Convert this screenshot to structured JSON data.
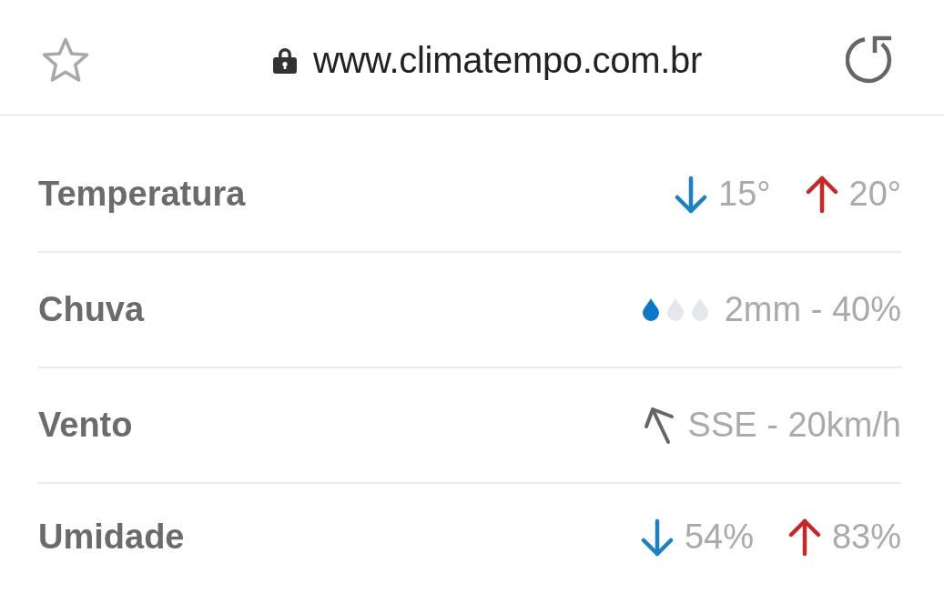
{
  "toolbar": {
    "bookmarked": false,
    "url": "www.climatempo.com.br"
  },
  "rows": [
    {
      "kind": "range",
      "label": "Temperatura",
      "min": "15°",
      "max": "20°"
    },
    {
      "kind": "rain",
      "label": "Chuva",
      "drops": [
        {
          "filled": true
        },
        {
          "filled": false
        },
        {
          "filled": false
        }
      ],
      "value": "2mm - 40%"
    },
    {
      "kind": "wind",
      "label": "Vento",
      "value": "SSE - 20km/h"
    },
    {
      "kind": "range",
      "label": "Umidade",
      "min": "54%",
      "max": "83%"
    }
  ]
}
